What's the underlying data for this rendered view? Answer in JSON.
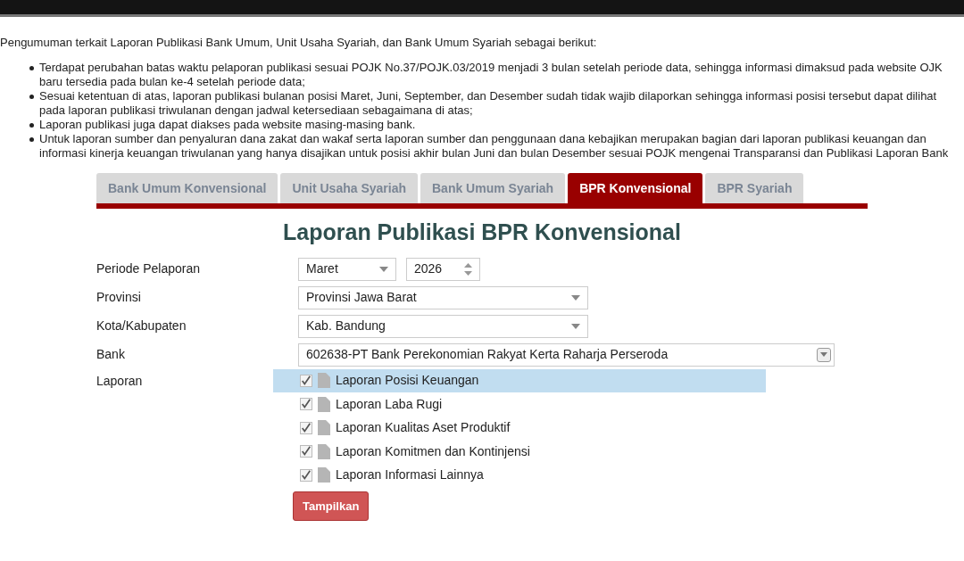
{
  "announcement": {
    "intro": "Pengumuman terkait Laporan Publikasi Bank Umum, Unit Usaha Syariah, dan Bank Umum Syariah sebagai berikut:",
    "bullets": [
      "Terdapat perubahan batas waktu pelaporan publikasi sesuai POJK No.37/POJK.03/2019 menjadi 3 bulan setelah periode data, sehingga informasi dimaksud pada website OJK baru tersedia pada bulan ke-4 setelah periode data;",
      "Sesuai ketentuan di atas, laporan publikasi bulanan posisi Maret, Juni, September, dan Desember sudah tidak wajib dilaporkan sehingga informasi posisi tersebut dapat dilihat pada laporan publikasi triwulanan dengan jadwal ketersediaan sebagaimana di atas;",
      "Laporan publikasi juga dapat diakses pada website masing-masing bank.",
      "Untuk laporan sumber dan penyaluran dana zakat dan wakaf serta laporan sumber dan penggunaan dana kebajikan merupakan bagian dari laporan publikasi keuangan dan informasi kinerja keuangan triwulanan yang hanya disajikan untuk posisi akhir bulan Juni dan bulan Desember sesuai POJK mengenai Transparansi dan Publikasi Laporan Bank"
    ]
  },
  "tabs": [
    {
      "label": "Bank Umum Konvensional",
      "selected": false
    },
    {
      "label": "Unit Usaha Syariah",
      "selected": false
    },
    {
      "label": "Bank Umum Syariah",
      "selected": false
    },
    {
      "label": "BPR Konvensional",
      "selected": true
    },
    {
      "label": "BPR Syariah",
      "selected": false
    }
  ],
  "title": "Laporan Publikasi BPR Konvensional",
  "form": {
    "period": {
      "label": "Periode Pelaporan",
      "month": "Maret",
      "year": "2026"
    },
    "province": {
      "label": "Provinsi",
      "value": "Provinsi Jawa Barat"
    },
    "city": {
      "label": "Kota/Kabupaten",
      "value": "Kab. Bandung"
    },
    "bank": {
      "label": "Bank",
      "value": "602638-PT Bank Perekonomian Rakyat Kerta Raharja Perseroda"
    },
    "reports": {
      "label": "Laporan",
      "items": [
        {
          "label": "Laporan Posisi Keuangan",
          "checked": true,
          "selected": true
        },
        {
          "label": "Laporan Laba Rugi",
          "checked": true,
          "selected": false
        },
        {
          "label": "Laporan Kualitas Aset Produktif",
          "checked": true,
          "selected": false
        },
        {
          "label": "Laporan Komitmen dan Kontinjensi",
          "checked": true,
          "selected": false
        },
        {
          "label": "Laporan Informasi Lainnya",
          "checked": true,
          "selected": false
        }
      ]
    }
  },
  "submit": "Tampilkan"
}
